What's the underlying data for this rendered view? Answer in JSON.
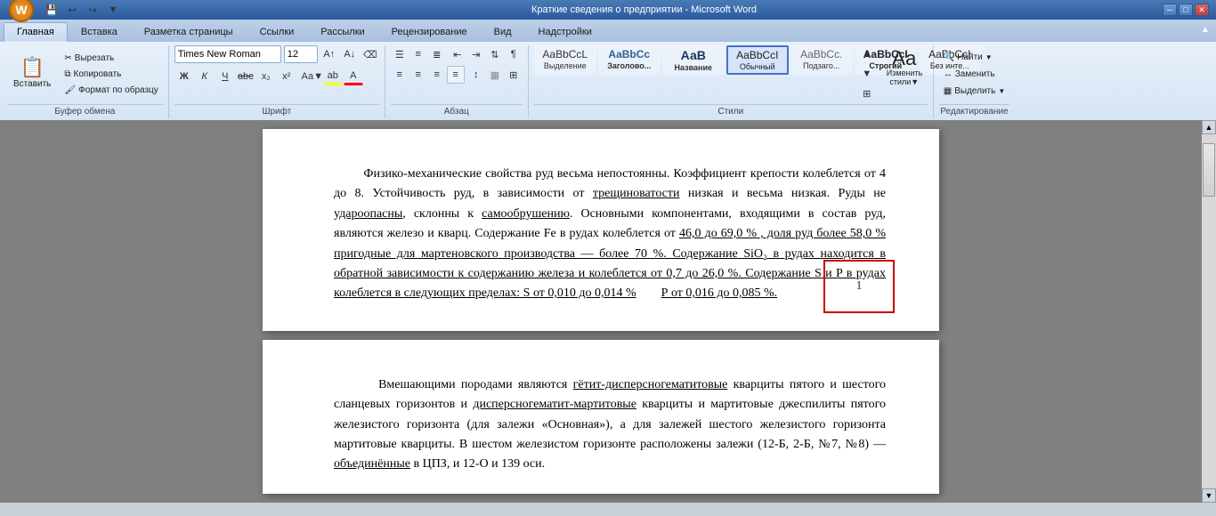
{
  "titlebar": {
    "title": "Краткие сведения о предприятии - Microsoft Word",
    "minimize": "─",
    "maximize": "□",
    "close": "✕"
  },
  "quickaccess": {
    "save": "💾",
    "undo": "↩",
    "redo": "↪",
    "dropdown": "▼"
  },
  "ribbon": {
    "tabs": [
      {
        "label": "Главная",
        "active": true
      },
      {
        "label": "Вставка",
        "active": false
      },
      {
        "label": "Разметка страницы",
        "active": false
      },
      {
        "label": "Ссылки",
        "active": false
      },
      {
        "label": "Рассылки",
        "active": false
      },
      {
        "label": "Рецензирование",
        "active": false
      },
      {
        "label": "Вид",
        "active": false
      },
      {
        "label": "Надстройки",
        "active": false
      }
    ],
    "groups": {
      "clipboard": {
        "label": "Буфер обмена",
        "paste_label": "Вставить",
        "cut": "Вырезать",
        "copy": "Копировать",
        "format_painter": "Формат по образцу"
      },
      "font": {
        "label": "Шрифт",
        "font_name": "Times New Roman",
        "font_size": "12",
        "bold": "Ж",
        "italic": "К",
        "underline": "Ч",
        "strikethrough": "abc",
        "subscript": "x₂",
        "superscript": "x²",
        "change_case": "Аа",
        "highlight": "ab",
        "font_color": "А"
      },
      "paragraph": {
        "label": "Абзац"
      },
      "styles": {
        "label": "Стили",
        "items": [
          {
            "label": "AaBbCcL",
            "name": "Выделение",
            "active": false,
            "style": "normal"
          },
          {
            "label": "AaBbCс",
            "name": "Заголово...",
            "active": false,
            "style": "heading1"
          },
          {
            "label": "АаВ",
            "name": "Название",
            "active": false,
            "style": "title"
          },
          {
            "label": "AaBbCcI",
            "name": "Обычный",
            "active": true,
            "style": "normal"
          },
          {
            "label": "AaBbCс.",
            "name": "Подзаго...",
            "active": false,
            "style": "subtitle"
          },
          {
            "label": "AaBbCcI",
            "name": "Строгий",
            "active": false,
            "style": "intense"
          },
          {
            "label": "AaBbCcI",
            "name": "Без инте...",
            "active": false,
            "style": "no_intense"
          }
        ]
      },
      "editing": {
        "label": "Редактирование",
        "find": "Найти",
        "replace": "Заменить",
        "select": "Выделить"
      }
    }
  },
  "document": {
    "page1": {
      "paragraphs": [
        "        Физико-механические свойства руд весьма непостоянны. Коэффициент крепости колеблется от 4 до 8. Устойчивость руд, в зависимости от трещиноватости низкая и весьма низкая. Руды не удароопасны, склонны к самообрушению. Основными компонентами, входящими в состав руд, являются железо и кварц. Содержание Fe в рудах колеблется от 46,0 до 69,0 % , доля руд более 58,0 % пригодные для мартеновского производства — более 70 %. Содержание SiO₂ в рудах находится в обратной зависимости к содержанию железа и колеблется от 0,7 до 26,0 %. Содержание S и P в рудах колеблется в следующих пределах: S от 0,010 до 0,014 %        Р от 0,016 до 0,085 %."
      ],
      "page_number": "1"
    },
    "page2": {
      "paragraphs": [
        "        Вмешающими породами являются гётит-дисперсногематитовые кварциты пятого и шестого сланцевых горизонтов и дисперсногематит-мартитовые кварциты и мартитовые джеспилиты пятого железистого горизонта (для залежи «Основная»), а для залежей шестого железистого горизонта мартитовые кварциты. В шестом железистом горизонте расположены залежи (12-Б, 2-Б, №7, №8) — объединённые в ЦПЗ, и 12-О и 139 оси."
      ]
    }
  }
}
